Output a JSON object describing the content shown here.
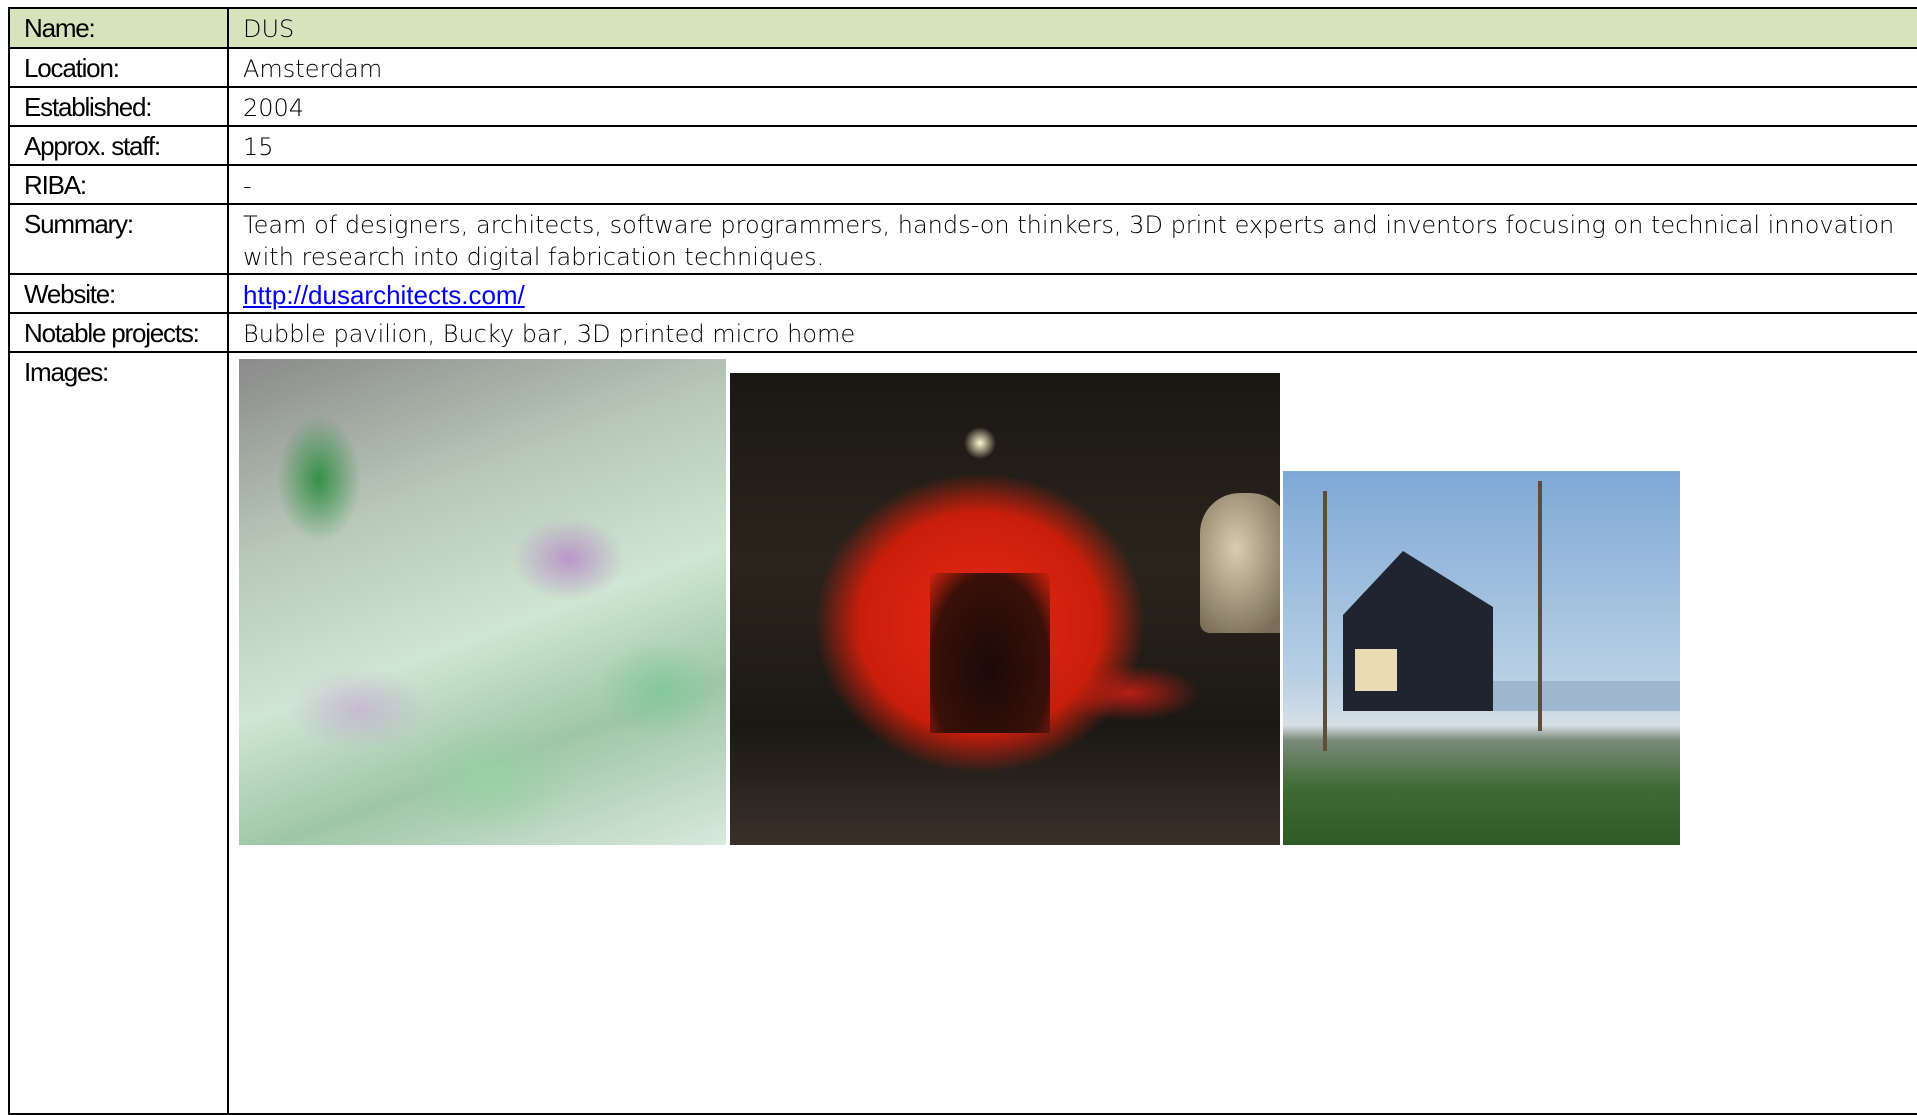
{
  "rows": {
    "name": {
      "label": "Name:",
      "value": "DUS"
    },
    "location": {
      "label": "Location:",
      "value": "Amsterdam"
    },
    "established": {
      "label": "Established:",
      "value": "2004"
    },
    "staff": {
      "label": "Approx. staff:",
      "value": "15"
    },
    "riba": {
      "label": "RIBA:",
      "value": "-"
    },
    "summary": {
      "label": "Summary:",
      "value": "Team of designers, architects, software programmers, hands-on thinkers, 3D print experts and inventors focusing on technical innovation with research into digital fabrication techniques."
    },
    "website": {
      "label": "Website:",
      "value": "http://dusarchitects.com/"
    },
    "projects": {
      "label": "Notable projects:",
      "value": "Bubble pavilion, Bucky bar, 3D printed micro home"
    },
    "images": {
      "label": "Images:"
    }
  },
  "colors": {
    "header_row_bg": "#d6e3bc",
    "link": "#0000ee"
  }
}
